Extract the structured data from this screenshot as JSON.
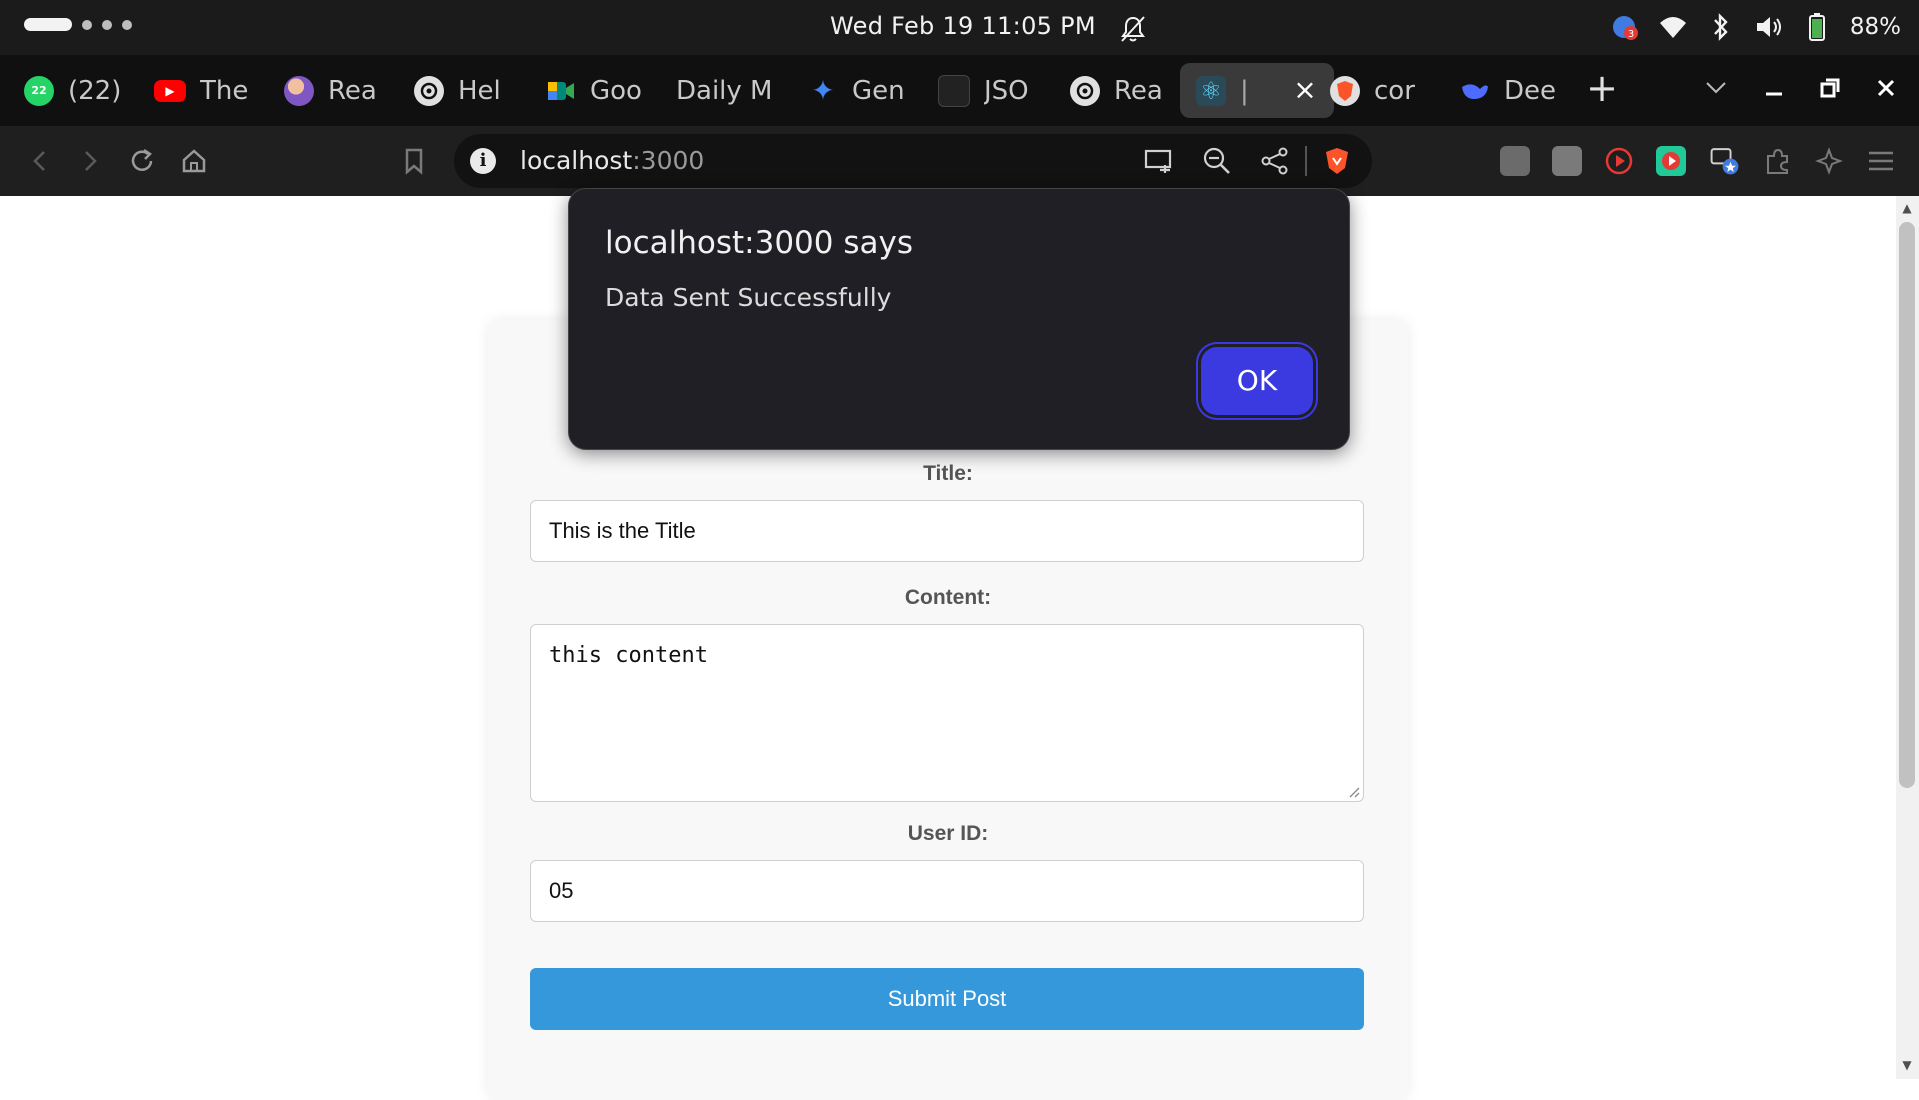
{
  "os_bar": {
    "clock": "Wed Feb 19  11:05 PM",
    "battery_percent": "88%",
    "tray_badge": "3"
  },
  "tabs": [
    {
      "label": "(22)",
      "icon": "whatsapp-icon",
      "color": "#25d366",
      "fav_text": "22"
    },
    {
      "label": "The",
      "icon": "youtube-icon",
      "color": "#ff0000",
      "fav_text": "▶"
    },
    {
      "label": "Rea",
      "icon": "avatar-icon",
      "color": "#7e57c2",
      "fav_text": ""
    },
    {
      "label": "Hel",
      "icon": "chatgpt-icon",
      "color": "#e0e0e0",
      "fav_text": ""
    },
    {
      "label": "Goo",
      "icon": "google-meet-icon",
      "color": "#00897b",
      "fav_text": ""
    },
    {
      "label": "Daily M",
      "icon": "",
      "color": "",
      "fav_text": ""
    },
    {
      "label": "Gen",
      "icon": "gemini-icon",
      "color": "#4285f4",
      "fav_text": "✦"
    },
    {
      "label": "JSO",
      "icon": "json-icon",
      "color": "#222222",
      "fav_text": ""
    },
    {
      "label": "Rea",
      "icon": "chatgpt-icon",
      "color": "#e0e0e0",
      "fav_text": ""
    },
    {
      "label": "|",
      "icon": "react-icon",
      "color": "#61dafb",
      "fav_text": "⚛"
    },
    {
      "label": "cor",
      "icon": "brave-icon",
      "color": "#fb542b",
      "fav_text": ""
    },
    {
      "label": "Dee",
      "icon": "deepseek-icon",
      "color": "#4d6bfe",
      "fav_text": ""
    }
  ],
  "address_bar": {
    "host": "localhost",
    "port": ":3000"
  },
  "form": {
    "title_label": "Title:",
    "title_value": "This is the Title",
    "content_label": "Content:",
    "content_value": "this content",
    "user_id_label": "User ID:",
    "user_id_value": "05",
    "submit_label": "Submit Post"
  },
  "dialog": {
    "title": "localhost:3000 says",
    "message": "Data Sent Successfully",
    "ok_label": "OK"
  },
  "colors": {
    "submit_button": "#3498db",
    "dialog_ok": "#3a3ae0",
    "dialog_bg": "#1f1f25"
  }
}
